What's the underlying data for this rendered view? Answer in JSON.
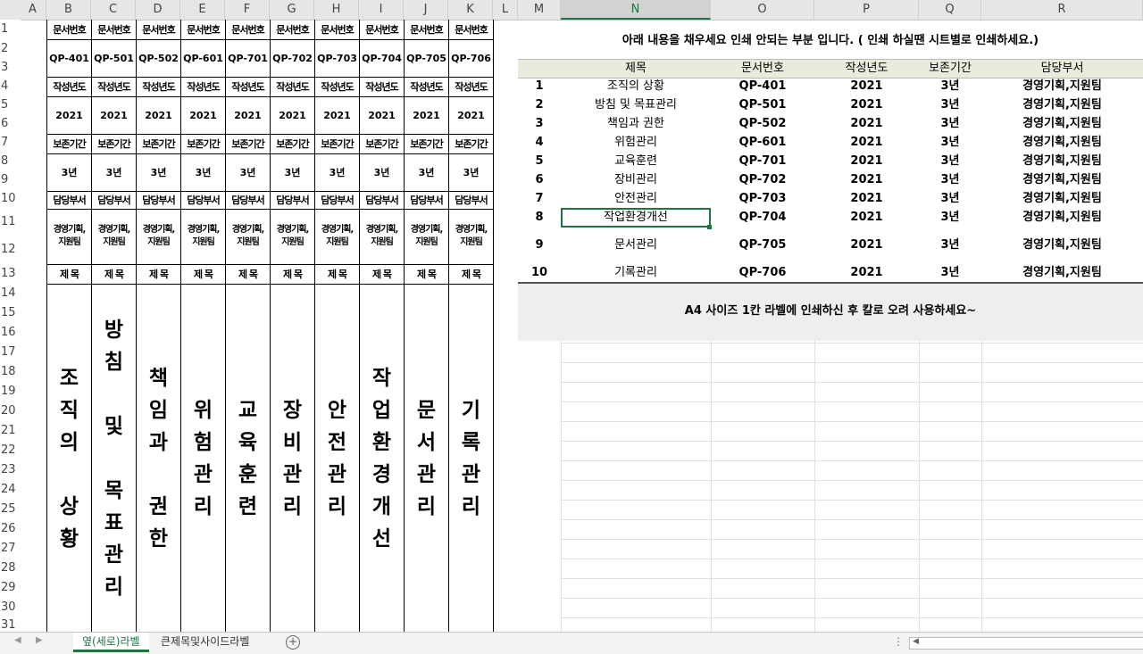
{
  "columns": [
    "A",
    "B",
    "C",
    "D",
    "E",
    "F",
    "G",
    "H",
    "I",
    "J",
    "K",
    "L",
    "M",
    "N",
    "O",
    "P",
    "Q",
    "R"
  ],
  "rows": [
    "1",
    "2",
    "3",
    "4",
    "5",
    "6",
    "7",
    "8",
    "9",
    "10",
    "11",
    "12",
    "13",
    "14",
    "15",
    "16",
    "17",
    "18",
    "19",
    "20",
    "21",
    "22",
    "23",
    "24",
    "25",
    "26",
    "27",
    "28",
    "29",
    "30",
    "31"
  ],
  "left_labels": {
    "head_doc": "문서번호",
    "head_year": "작성년도",
    "head_keep": "보존기간",
    "head_dept": "담당부서",
    "head_title": "제   목",
    "items": [
      {
        "code": "QP-401",
        "year": "2021",
        "keep": "3년",
        "dept": "경영기획,\n지원팀",
        "title": "조\n직\n의\n\n상\n황"
      },
      {
        "code": "QP-501",
        "year": "2021",
        "keep": "3년",
        "dept": "경영기획,\n지원팀",
        "title": "방\n침\n\n및\n\n목\n표\n관\n리"
      },
      {
        "code": "QP-502",
        "year": "2021",
        "keep": "3년",
        "dept": "경영기획,\n지원팀",
        "title": "책\n임\n과\n\n권\n한"
      },
      {
        "code": "QP-601",
        "year": "2021",
        "keep": "3년",
        "dept": "경영기획,\n지원팀",
        "title": "위\n험\n관\n리"
      },
      {
        "code": "QP-701",
        "year": "2021",
        "keep": "3년",
        "dept": "경영기획,\n지원팀",
        "title": "교\n육\n훈\n련"
      },
      {
        "code": "QP-702",
        "year": "2021",
        "keep": "3년",
        "dept": "경영기획,\n지원팀",
        "title": "장\n비\n관\n리"
      },
      {
        "code": "QP-703",
        "year": "2021",
        "keep": "3년",
        "dept": "경영기획,\n지원팀",
        "title": "안\n전\n관\n리"
      },
      {
        "code": "QP-704",
        "year": "2021",
        "keep": "3년",
        "dept": "경영기획,\n지원팀",
        "title": "작\n업\n환\n경\n개\n선"
      },
      {
        "code": "QP-705",
        "year": "2021",
        "keep": "3년",
        "dept": "경영기획,\n지원팀",
        "title": "문\n서\n관\n리"
      },
      {
        "code": "QP-706",
        "year": "2021",
        "keep": "3년",
        "dept": "경영기획,\n지원팀",
        "title": "기\n록\n관\n리"
      }
    ]
  },
  "notice": "아래 내용을 채우세요 인쇄 안되는 부분 입니다. ( 인쇄 하실땐 시트별로 인쇄하세요.)",
  "table": {
    "headers": [
      "",
      "제목",
      "문서번호",
      "작성년도",
      "보존기간",
      "담당부서"
    ],
    "rows": [
      [
        "1",
        "조직의 상황",
        "QP-401",
        "2021",
        "3년",
        "경영기획,지원팀"
      ],
      [
        "2",
        "방침 및 목표관리",
        "QP-501",
        "2021",
        "3년",
        "경영기획,지원팀"
      ],
      [
        "3",
        "책임과 권한",
        "QP-502",
        "2021",
        "3년",
        "경영기획,지원팀"
      ],
      [
        "4",
        "위험관리",
        "QP-601",
        "2021",
        "3년",
        "경영기획,지원팀"
      ],
      [
        "5",
        "교육훈련",
        "QP-701",
        "2021",
        "3년",
        "경영기획,지원팀"
      ],
      [
        "6",
        "장비관리",
        "QP-702",
        "2021",
        "3년",
        "경영기획,지원팀"
      ],
      [
        "7",
        "안전관리",
        "QP-703",
        "2021",
        "3년",
        "경영기획,지원팀"
      ],
      [
        "8",
        "작업환경개선",
        "QP-704",
        "2021",
        "3년",
        "경영기획,지원팀"
      ],
      [
        "9",
        "문서관리",
        "QP-705",
        "2021",
        "3년",
        "경영기획,지원팀"
      ],
      [
        "10",
        "기록관리",
        "QP-706",
        "2021",
        "3년",
        "경영기획,지원팀"
      ]
    ]
  },
  "hint": "A4 사이즈 1칸 라벨에 인쇄하신 후 칼로 오려 사용하세요~",
  "tabs": [
    {
      "label": "옆(세로)라벨",
      "active": true
    },
    {
      "label": "큰제목및사이드라벨",
      "active": false
    }
  ],
  "selected_column": "N",
  "colors": {
    "accent": "#217346",
    "header_bg": "#e8ecdc",
    "hint_bg": "#eeeeee"
  }
}
